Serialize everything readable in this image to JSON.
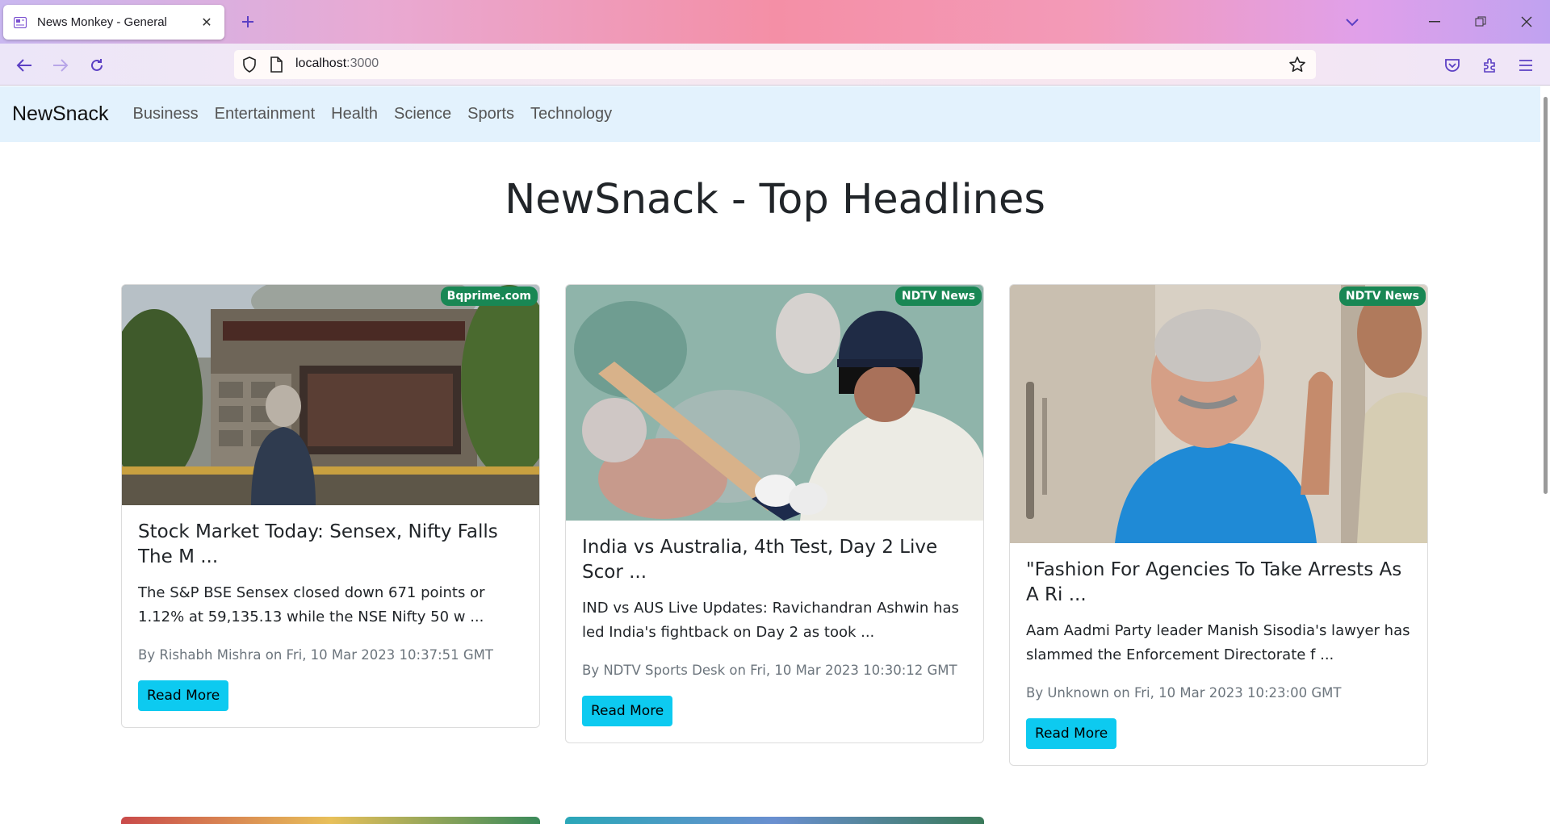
{
  "browser": {
    "tab_title": "News Monkey - General",
    "tab_close": "✕",
    "new_tab": "+",
    "url_host": "localhost",
    "url_port": ":3000",
    "icons": [
      "back-icon",
      "forward-icon",
      "reload-icon",
      "shield-icon",
      "page-icon",
      "star-icon",
      "pocket-icon",
      "extensions-icon",
      "menu-icon",
      "tab-list-icon",
      "minimize-icon",
      "restore-icon",
      "close-window-icon"
    ]
  },
  "site": {
    "brand": "NewSnack",
    "nav": [
      "Business",
      "Entertainment",
      "Health",
      "Science",
      "Sports",
      "Technology"
    ],
    "headline": "NewSnack - Top Headlines"
  },
  "articles": [
    {
      "source": "Bqprime.com",
      "title": "Stock Market Today: Sensex, Nifty Falls The M ...",
      "description": "The S&P BSE Sensex closed down 671 points or 1.12% at 59,135.13 while the NSE Nifty 50 w ...",
      "meta": "By Rishabh Mishra on Fri, 10 Mar 2023 10:37:51 GMT",
      "button": "Read More"
    },
    {
      "source": "NDTV News",
      "title": "India vs Australia, 4th Test, Day 2 Live Scor ...",
      "description": "IND vs AUS Live Updates: Ravichandran Ashwin has led India's fightback on Day 2 as took ...",
      "meta": "By NDTV Sports Desk on Fri, 10 Mar 2023 10:30:12 GMT",
      "button": "Read More"
    },
    {
      "source": "NDTV News",
      "title": "\"Fashion For Agencies To Take Arrests As A Ri ...",
      "description": "Aam Aadmi Party leader Manish Sisodia's lawyer has slammed the Enforcement Directorate f ...",
      "meta": "By Unknown on Fri, 10 Mar 2023 10:23:00 GMT",
      "button": "Read More"
    }
  ],
  "colors": {
    "nav_bg": "#e3f2fd",
    "badge": "#198754",
    "button": "#0dcaf0",
    "text": "#212529",
    "muted": "#6c757d"
  }
}
